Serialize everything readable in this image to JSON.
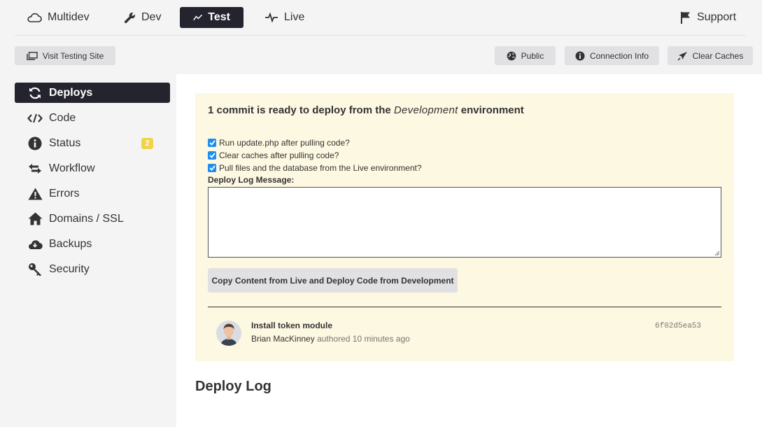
{
  "env_tabs": [
    {
      "label": "Multidev",
      "icon": "cloud-icon"
    },
    {
      "label": "Dev",
      "icon": "wrench-icon"
    },
    {
      "label": "Test",
      "icon": "chart-line-icon",
      "active": true
    },
    {
      "label": "Live",
      "icon": "pulse-icon"
    }
  ],
  "support": {
    "label": "Support",
    "icon": "flag-icon"
  },
  "toolbar": {
    "visit_site": "Visit Testing Site",
    "public": "Public",
    "connection_info": "Connection Info",
    "clear_caches": "Clear Caches"
  },
  "sidebar": {
    "items": [
      {
        "label": "Deploys",
        "icon": "sync-icon",
        "active": true
      },
      {
        "label": "Code",
        "icon": "code-icon"
      },
      {
        "label": "Status",
        "icon": "info-icon",
        "badge": "2"
      },
      {
        "label": "Workflow",
        "icon": "arrows-exchange-icon"
      },
      {
        "label": "Errors",
        "icon": "warning-icon"
      },
      {
        "label": "Domains / SSL",
        "icon": "home-icon"
      },
      {
        "label": "Backups",
        "icon": "cloud-download-icon"
      },
      {
        "label": "Security",
        "icon": "key-icon"
      }
    ]
  },
  "deploy": {
    "title_prefix": "1 commit is ready to deploy from the",
    "title_env": "Development",
    "title_suffix": "environment",
    "options": [
      {
        "label": "Run update.php after pulling code?",
        "checked": true
      },
      {
        "label": "Clear caches after pulling code?",
        "checked": true
      },
      {
        "label": "Pull files and the database from the Live environment?",
        "checked": true
      }
    ],
    "log_label": "Deploy Log Message:",
    "log_value": "",
    "button_label": "Copy Content from Live and Deploy Code from Development"
  },
  "commit": {
    "title": "Install token module",
    "author": "Brian MacKinney",
    "meta": "authored 10 minutes ago",
    "hash": "6f02d5ea53"
  },
  "deploy_log_title": "Deploy Log",
  "colors": {
    "dark": "#23242d",
    "accent_yellow": "#f2d24a",
    "panel_yellow": "#fdf8e1",
    "checkbox_blue": "#1f8ef1"
  }
}
